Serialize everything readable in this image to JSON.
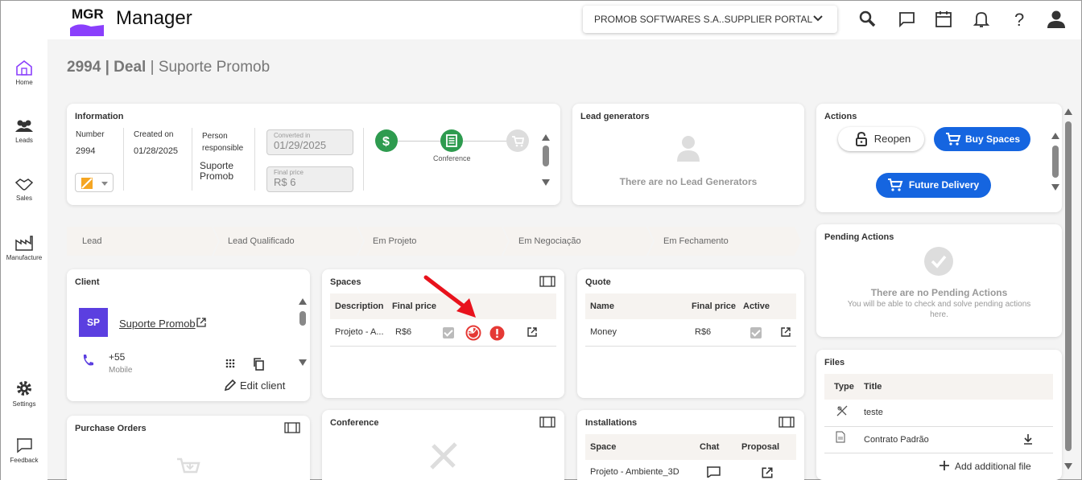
{
  "header": {
    "logo_text": "MGR",
    "app_title": "Manager",
    "portal_select": "PROMOB SOFTWARES S.A..SUPPLIER PORTAL"
  },
  "sidebar": {
    "items": [
      {
        "label": "Home"
      },
      {
        "label": "Leads"
      },
      {
        "label": "Sales"
      },
      {
        "label": "Manufacture"
      },
      {
        "label": "Settings"
      },
      {
        "label": "Feedback"
      }
    ]
  },
  "page": {
    "id": "2994",
    "type": "Deal",
    "name": "Suporte Promob",
    "separator": "|"
  },
  "information": {
    "title": "Information",
    "number_label": "Number",
    "number_value": "2994",
    "created_label": "Created on",
    "created_value": "01/28/2025",
    "person_label_1": "Person",
    "person_label_2": "responsible",
    "person_value_1": "Suporte",
    "person_value_2": "Promob",
    "converted_label": "Converted in",
    "converted_value": "01/29/2025",
    "final_price_label": "Final price",
    "final_price_value": "R$ 6",
    "step_label": "Conference"
  },
  "lead_generators": {
    "title": "Lead generators",
    "empty": "There are no Lead Generators"
  },
  "actions": {
    "title": "Actions",
    "reopen": "Reopen",
    "buy_spaces": "Buy Spaces",
    "future_delivery": "Future Delivery"
  },
  "pipeline": {
    "stages": [
      "Lead",
      "Lead Qualificado",
      "Em Projeto",
      "Em Negociação",
      "Em Fechamento"
    ]
  },
  "pending": {
    "title": "Pending Actions",
    "empty": "There are no Pending Actions",
    "hint_1": "You will be able to check and solve pending actions",
    "hint_2": "here."
  },
  "client": {
    "title": "Client",
    "avatar": "SP",
    "name": "Suporte Promob",
    "phone": "+55",
    "phone_type": "Mobile",
    "edit": "Edit client"
  },
  "spaces": {
    "title": "Spaces",
    "col_description": "Description",
    "col_final_price": "Final price",
    "row_description": "Projeto - A...",
    "row_price": "R$6"
  },
  "quote": {
    "title": "Quote",
    "col_name": "Name",
    "col_final_price": "Final price",
    "col_active": "Active",
    "row_name": "Money",
    "row_price": "R$6"
  },
  "files": {
    "title": "Files",
    "col_type": "Type",
    "col_title": "Title",
    "rows": [
      {
        "title": "teste"
      },
      {
        "title": "Contrato Padrão"
      }
    ],
    "add": "Add additional file"
  },
  "purchase_orders": {
    "title": "Purchase Orders"
  },
  "conference": {
    "title": "Conference"
  },
  "installations": {
    "title": "Installations",
    "col_space": "Space",
    "col_chat": "Chat",
    "col_proposal": "Proposal",
    "row_space": "Projeto - Ambiente_3D"
  },
  "colors": {
    "primary": "#1565e0",
    "green": "#2e9b4f",
    "avatar": "#5b3fe0",
    "alert_red": "#e53935",
    "logo_purple": "#8a3ffc"
  }
}
